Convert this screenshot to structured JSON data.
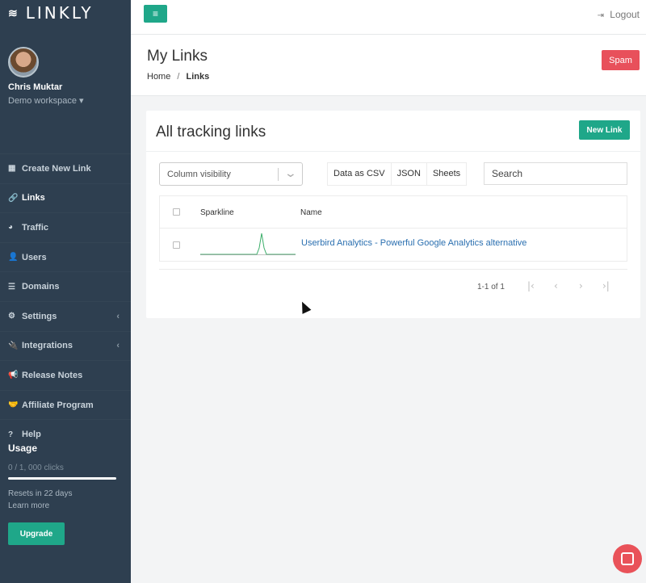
{
  "sidebar": {
    "brand": "LINKLY",
    "brand_icon": "≋",
    "profile": {
      "name": "Chris Muktar",
      "workspace": "Demo workspace ▾"
    },
    "items": [
      {
        "label": "Create New Link",
        "icon": "▦",
        "icon_name": "grid-icon",
        "chevron": ""
      },
      {
        "label": "Links",
        "icon": "🔗",
        "icon_name": "link-icon",
        "chevron": ""
      },
      {
        "label": "Traffic",
        "icon": "◕",
        "icon_name": "pie-chart-icon",
        "chevron": ""
      },
      {
        "label": "Users",
        "icon": "👤",
        "icon_name": "user-icon",
        "chevron": ""
      },
      {
        "label": "Domains",
        "icon": "☰",
        "icon_name": "list-icon",
        "chevron": ""
      },
      {
        "label": "Settings",
        "icon": "⚙",
        "icon_name": "gears-icon",
        "chevron": "‹"
      },
      {
        "label": "Integrations",
        "icon": "🔌",
        "icon_name": "plug-icon",
        "chevron": "‹"
      },
      {
        "label": "Release Notes",
        "icon": "📢",
        "icon_name": "bullhorn-icon",
        "chevron": ""
      },
      {
        "label": "Affiliate Program",
        "icon": "🤝",
        "icon_name": "handshake-icon",
        "chevron": ""
      },
      {
        "label": "Help",
        "icon": "?",
        "icon_name": "question-icon",
        "chevron": ""
      }
    ],
    "usage": {
      "title": "Usage",
      "clicks": "0 / 1, 000 clicks",
      "progress": 0,
      "resets": "Resets in 22 days",
      "learn_more": "Learn more",
      "upgrade_label": "Upgrade"
    }
  },
  "topbar": {
    "logout_label": "Logout",
    "menu_icon": "≡"
  },
  "header": {
    "title": "My Links",
    "breadcrumb": {
      "home": "Home",
      "sep": "/",
      "current": "Links"
    },
    "spam_label": "Spam"
  },
  "card": {
    "title": "All tracking links",
    "new_link_label": "New Link",
    "column_visibility": "Column visibility",
    "exports": [
      "Data as CSV",
      "JSON",
      "Sheets"
    ],
    "search_placeholder": "Search",
    "columns": {
      "sparkline": "Sparkline",
      "name": "Name"
    },
    "rows": [
      {
        "name": "Userbird Analytics - Powerful Google Analytics alternative"
      }
    ],
    "pagination": {
      "info": "1-1 of 1",
      "first": "|‹",
      "prev": "‹",
      "next": "›",
      "last": "›|"
    }
  },
  "colors": {
    "sidebar_bg": "#2e3f50",
    "accent": "#1fa789",
    "danger": "#e8505b",
    "link": "#2a6fb0"
  }
}
